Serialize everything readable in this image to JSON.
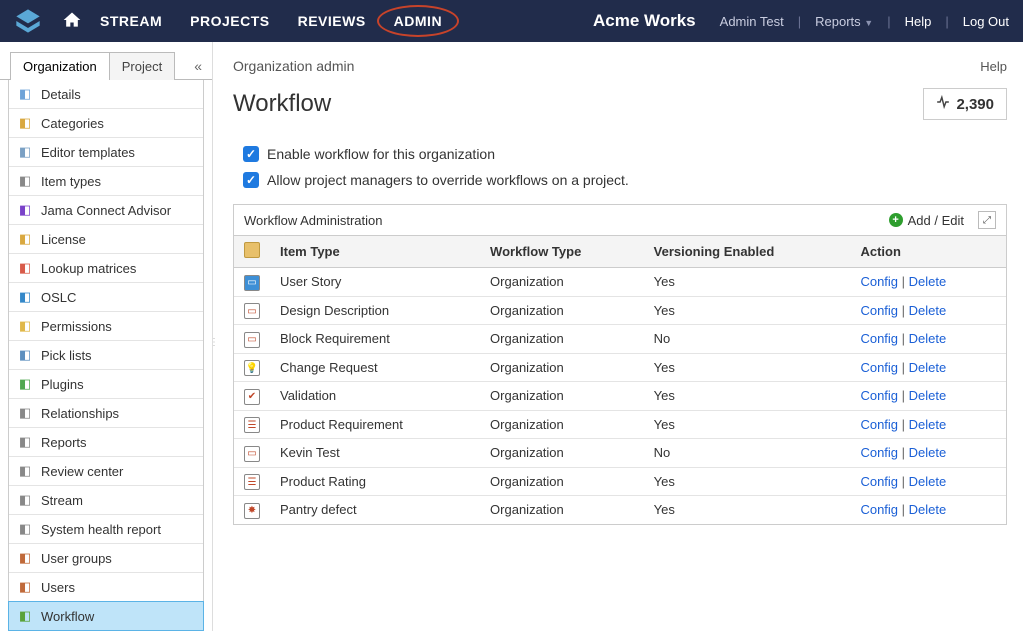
{
  "topnav": {
    "stream": "STREAM",
    "projects": "PROJECTS",
    "reviews": "REVIEWS",
    "admin": "ADMIN"
  },
  "org_name": "Acme Works",
  "top_right": {
    "user": "Admin Test",
    "reports": "Reports",
    "help": "Help",
    "logout": "Log Out"
  },
  "sidebar": {
    "tabs": {
      "organization": "Organization",
      "project": "Project"
    },
    "items": [
      {
        "label": "Details",
        "icon": "details-icon",
        "color": "#6ea3d8"
      },
      {
        "label": "Categories",
        "icon": "tag-icon",
        "color": "#d9a840"
      },
      {
        "label": "Editor templates",
        "icon": "template-icon",
        "color": "#7aa0c4"
      },
      {
        "label": "Item types",
        "icon": "item-types-icon",
        "color": "#888"
      },
      {
        "label": "Jama Connect Advisor",
        "icon": "advisor-icon",
        "color": "#7a42c9"
      },
      {
        "label": "License",
        "icon": "key-icon",
        "color": "#d9a840"
      },
      {
        "label": "Lookup matrices",
        "icon": "matrix-icon",
        "color": "#d85b4a"
      },
      {
        "label": "OSLC",
        "icon": "oslc-icon",
        "color": "#3488c9"
      },
      {
        "label": "Permissions",
        "icon": "shield-icon",
        "color": "#e0b84a"
      },
      {
        "label": "Pick lists",
        "icon": "list-icon",
        "color": "#5c8fbf"
      },
      {
        "label": "Plugins",
        "icon": "puzzle-icon",
        "color": "#4fa84f"
      },
      {
        "label": "Relationships",
        "icon": "link-icon",
        "color": "#888"
      },
      {
        "label": "Reports",
        "icon": "page-icon",
        "color": "#888"
      },
      {
        "label": "Review center",
        "icon": "review-icon",
        "color": "#888"
      },
      {
        "label": "Stream",
        "icon": "stream-icon",
        "color": "#888"
      },
      {
        "label": "System health report",
        "icon": "health-icon",
        "color": "#888"
      },
      {
        "label": "User groups",
        "icon": "groups-icon",
        "color": "#c06a3a"
      },
      {
        "label": "Users",
        "icon": "user-icon",
        "color": "#c06a3a"
      },
      {
        "label": "Workflow",
        "icon": "workflow-icon",
        "color": "#5aa33a",
        "selected": true
      }
    ]
  },
  "main": {
    "breadcrumb": "Organization admin",
    "help": "Help",
    "title": "Workflow",
    "metric": "2,390",
    "checks": {
      "enable_workflow": "Enable workflow for this organization",
      "allow_override": "Allow project managers to override workflows on a project."
    },
    "panel_title": "Workflow Administration",
    "add_edit": "Add / Edit",
    "columns": {
      "item_type": "Item Type",
      "workflow_type": "Workflow Type",
      "versioning": "Versioning Enabled",
      "action": "Action"
    },
    "action_config": "Config",
    "action_delete": "Delete",
    "rows": [
      {
        "item_type": "User Story",
        "workflow_type": "Organization",
        "versioning": "Yes",
        "icon_bg": "#3d8fd6",
        "icon_glyph": "▭"
      },
      {
        "item_type": "Design Description",
        "workflow_type": "Organization",
        "versioning": "Yes",
        "icon_bg": "#fff",
        "icon_glyph": "▭"
      },
      {
        "item_type": "Block Requirement",
        "workflow_type": "Organization",
        "versioning": "No",
        "icon_bg": "#fff",
        "icon_glyph": "▭"
      },
      {
        "item_type": "Change Request",
        "workflow_type": "Organization",
        "versioning": "Yes",
        "icon_bg": "#fff",
        "icon_glyph": "💡"
      },
      {
        "item_type": "Validation",
        "workflow_type": "Organization",
        "versioning": "Yes",
        "icon_bg": "#fff",
        "icon_glyph": "✔"
      },
      {
        "item_type": "Product Requirement",
        "workflow_type": "Organization",
        "versioning": "Yes",
        "icon_bg": "#fff",
        "icon_glyph": "☰"
      },
      {
        "item_type": "Kevin Test",
        "workflow_type": "Organization",
        "versioning": "No",
        "icon_bg": "#fff",
        "icon_glyph": "▭"
      },
      {
        "item_type": "Product Rating",
        "workflow_type": "Organization",
        "versioning": "Yes",
        "icon_bg": "#fff",
        "icon_glyph": "☰"
      },
      {
        "item_type": "Pantry defect",
        "workflow_type": "Organization",
        "versioning": "Yes",
        "icon_bg": "#fff",
        "icon_glyph": "✸"
      }
    ]
  }
}
